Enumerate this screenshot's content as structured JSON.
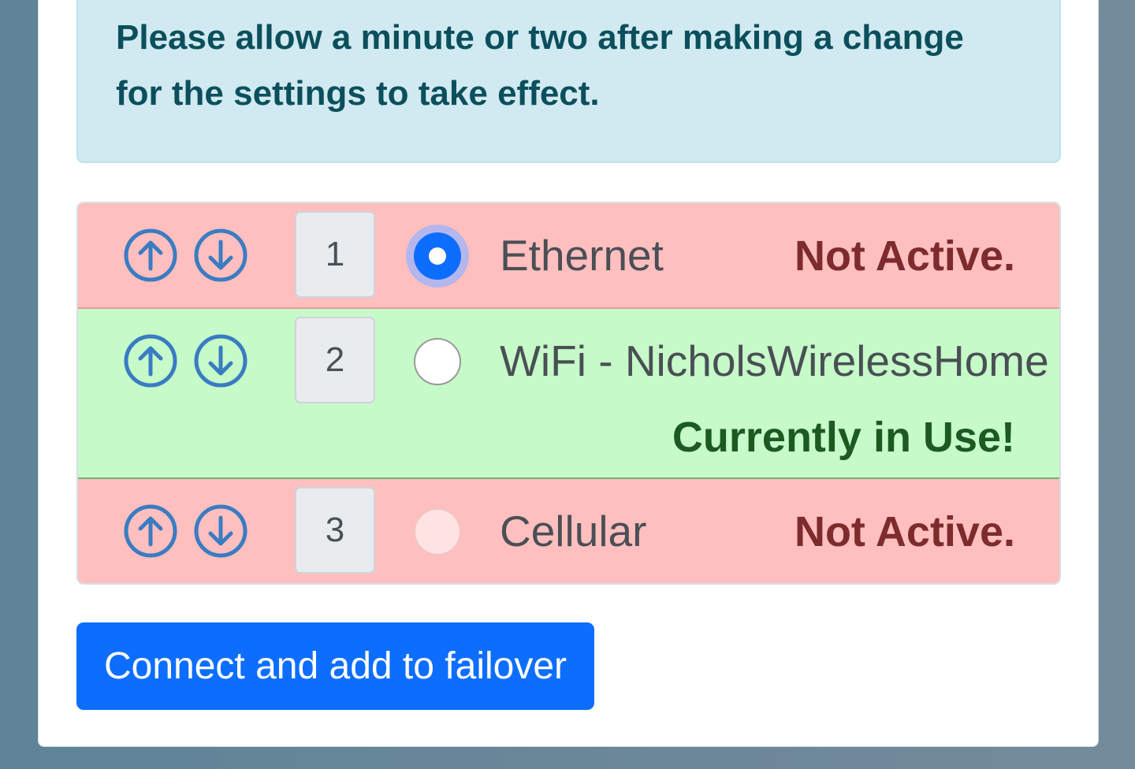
{
  "notice": {
    "text": "Please allow a minute or two after making a change for the settings to take effect."
  },
  "connections": [
    {
      "priority": "1",
      "name": "Ethernet",
      "status": "Not Active.",
      "selected": true
    },
    {
      "priority": "2",
      "name": "WiFi - NicholsWirelessHome",
      "status": "Currently in Use!",
      "selected": false
    },
    {
      "priority": "3",
      "name": "Cellular",
      "status": "Not Active.",
      "selected": false
    }
  ],
  "icons": {
    "move_up": "arrow-up-circle-icon",
    "move_down": "arrow-down-circle-icon"
  },
  "colors": {
    "primary": "#0d6efd",
    "inactive_row": "#ffbfbf",
    "active_row": "#c6fac8",
    "inactive_text": "#7d2b2d",
    "active_text": "#1c5a22",
    "notice_bg": "#d1e9f0",
    "notice_text": "#0b4f5c"
  },
  "actions": {
    "connect_label": "Connect and add to failover"
  }
}
